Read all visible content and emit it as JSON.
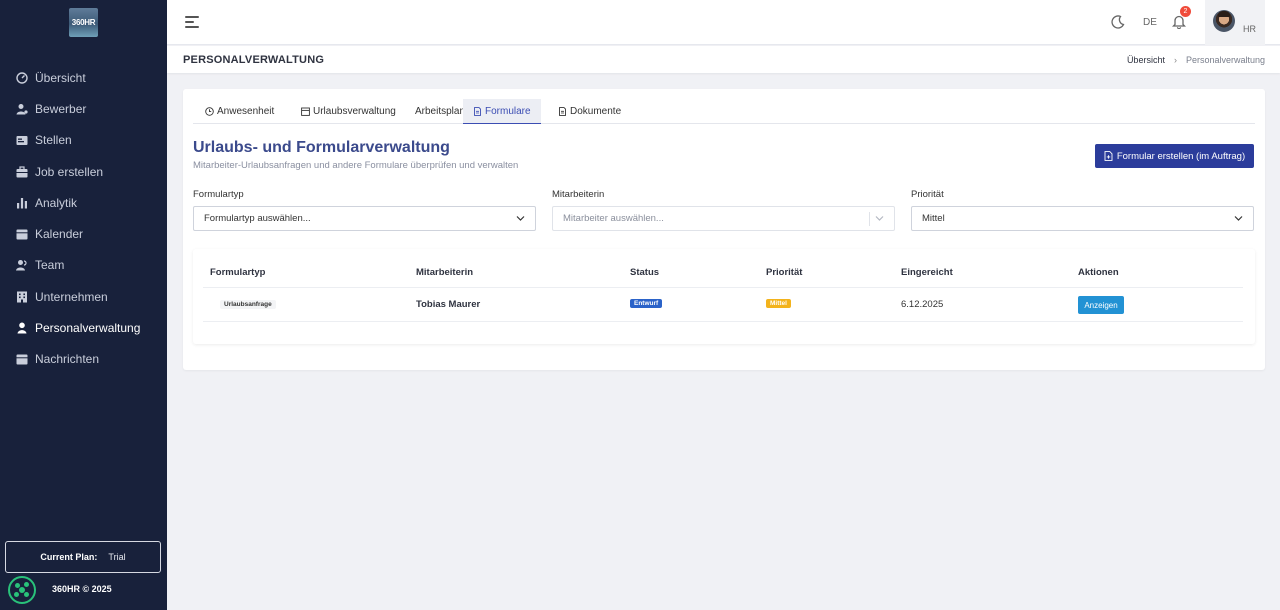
{
  "app": {
    "logo_text": "360HR",
    "footer": "360HR © 2025"
  },
  "sidebar": {
    "items": [
      {
        "label": "Übersicht",
        "icon": "dashboard-icon"
      },
      {
        "label": "Bewerber",
        "icon": "user-icon"
      },
      {
        "label": "Stellen",
        "icon": "briefcase-icon"
      },
      {
        "label": "Job erstellen",
        "icon": "job-create-icon"
      },
      {
        "label": "Analytik",
        "icon": "bar-chart-icon"
      },
      {
        "label": "Kalender",
        "icon": "calendar-icon"
      },
      {
        "label": "Team",
        "icon": "team-icon"
      },
      {
        "label": "Unternehmen",
        "icon": "building-icon"
      },
      {
        "label": "Personalverwaltung",
        "icon": "person-icon",
        "active": true
      },
      {
        "label": "Nachrichten",
        "icon": "message-icon"
      }
    ],
    "plan_label": "Current Plan:",
    "plan_value": "Trial"
  },
  "topbar": {
    "language": "DE",
    "notification_count": "2",
    "role": "HR"
  },
  "header": {
    "title": "PERSONALVERWALTUNG",
    "breadcrumb": [
      "Übersicht",
      "Personalverwaltung"
    ]
  },
  "tabs": [
    {
      "label": "Anwesenheit",
      "icon": "clock-icon"
    },
    {
      "label": "Urlaubsverwaltung",
      "icon": "calendar-icon"
    },
    {
      "label": "Arbeitsplan",
      "icon": ""
    },
    {
      "label": "Formulare",
      "icon": "document-icon",
      "active": true
    },
    {
      "label": "Dokumente",
      "icon": "document-icon"
    }
  ],
  "main": {
    "heading": "Urlaubs- und Formularverwaltung",
    "subheading": "Mitarbeiter-Urlaubsanfragen und andere Formulare überprüfen und verwalten",
    "create_button": "Formular erstellen (im Auftrag)"
  },
  "filters": {
    "type_label": "Formulartyp",
    "type_value": "Formulartyp auswählen...",
    "employee_label": "Mitarbeiterin",
    "employee_placeholder": "Mitarbeiter auswählen...",
    "priority_label": "Priorität",
    "priority_value": "Mittel"
  },
  "table": {
    "headers": [
      "Formulartyp",
      "Mitarbeiterin",
      "Status",
      "Priorität",
      "Eingereicht",
      "Aktionen"
    ],
    "rows": [
      {
        "type": "Urlaubsanfrage",
        "employee": "Tobias Maurer",
        "status": "Entwurf",
        "priority": "Mittel",
        "submitted": "6.12.2025",
        "action": "Anzeigen"
      }
    ]
  },
  "colors": {
    "sidebar_bg": "#18213b",
    "primary": "#2b3c9b",
    "status_draft": "#2b63c9",
    "priority_medium": "#f3b31c",
    "action_button": "#2292d4"
  }
}
